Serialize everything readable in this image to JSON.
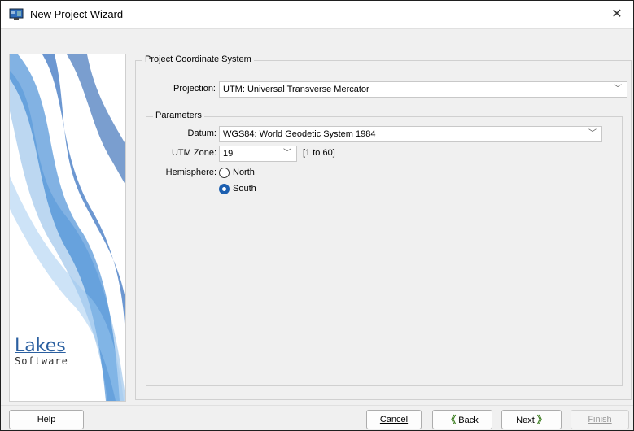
{
  "window": {
    "title": "New Project Wizard",
    "close": "✕"
  },
  "logo": {
    "lakes": "Lakes",
    "software": "Software"
  },
  "coord_group": {
    "title": "Project Coordinate System"
  },
  "projection": {
    "label": "Projection:",
    "value": "UTM: Universal Transverse Mercator"
  },
  "params_group": {
    "title": "Parameters"
  },
  "datum": {
    "label": "Datum:",
    "value": "WGS84: World Geodetic System 1984"
  },
  "utm_zone": {
    "label": "UTM Zone:",
    "value": "19",
    "range": "[1 to 60]"
  },
  "hemisphere": {
    "label": "Hemisphere:",
    "options": [
      {
        "label": "North",
        "selected": false
      },
      {
        "label": "South",
        "selected": true
      }
    ]
  },
  "footer": {
    "help": "Help",
    "cancel": "Cancel",
    "back": "Back",
    "next": "Next",
    "finish": "Finish"
  },
  "colors": {
    "accent": "#1c5fb0",
    "logo_blue": "#2a5fa0",
    "arrow_green": "#3b7d1f"
  }
}
